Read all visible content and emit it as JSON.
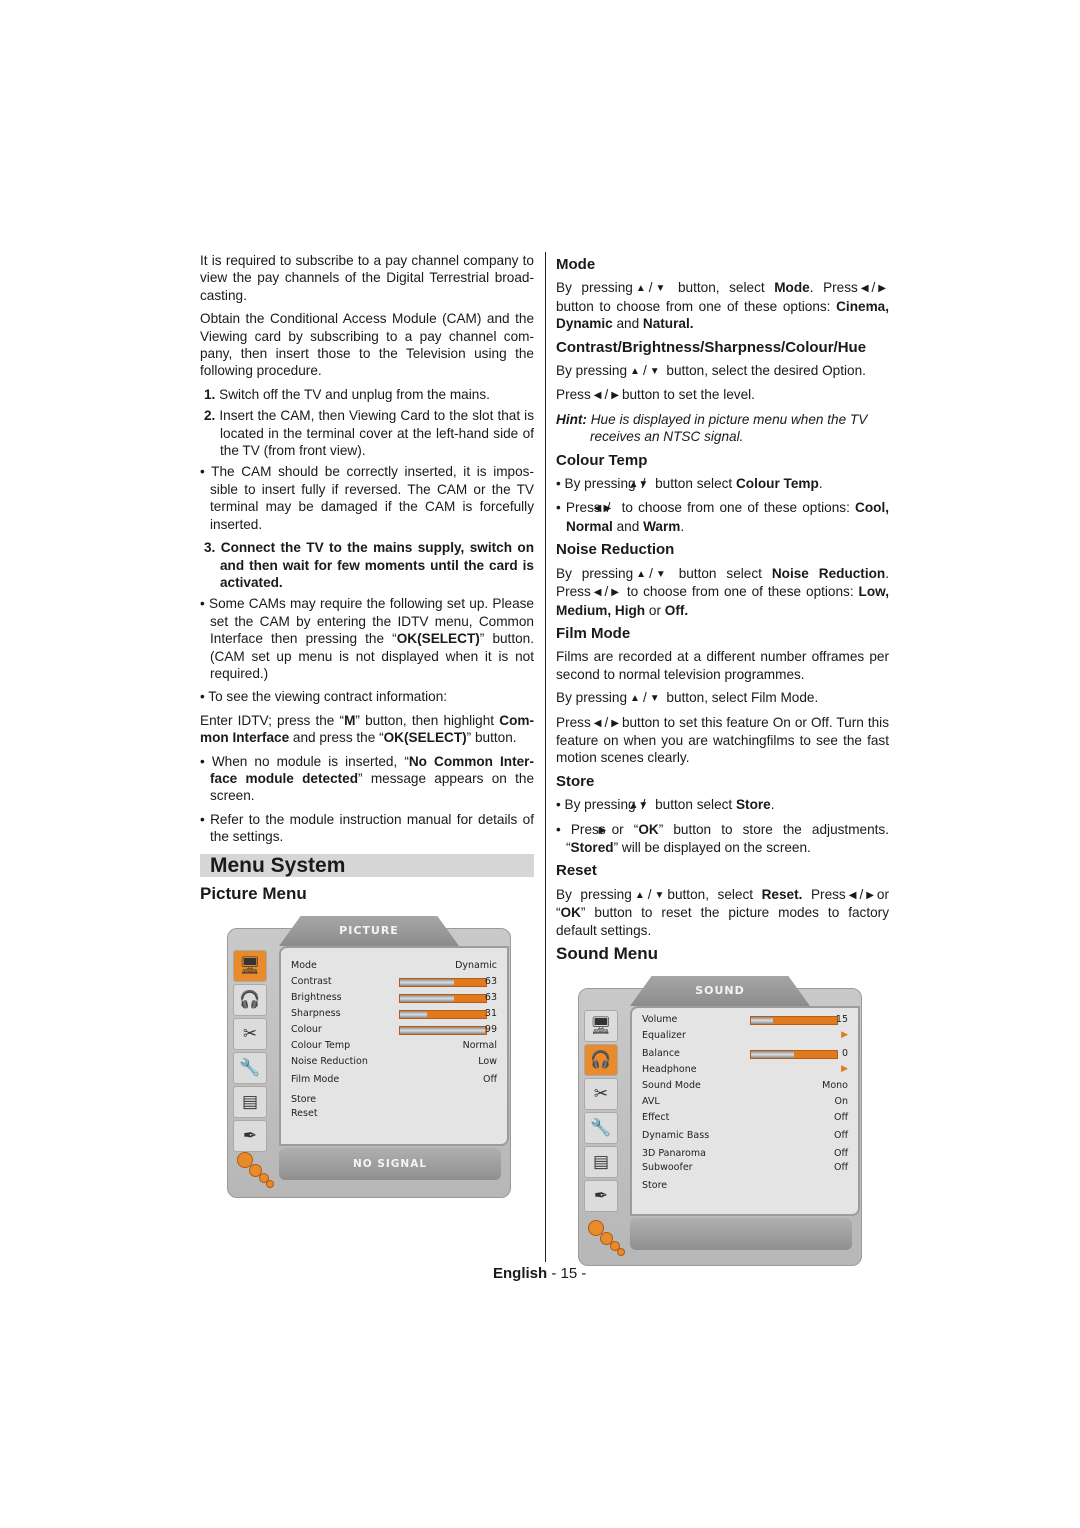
{
  "left": {
    "intro1": "It is required to subscribe to a pay channel company to view the pay channels of the Digital Terrestrial broad-casting.",
    "intro2": "Obtain the Conditional Access Module (CAM) and the Viewing card by subscribing to a pay channel com-pany, then insert those to the Television using the following procedure.",
    "step1_num": "1.",
    "step1": "Switch off the TV and unplug from the mains.",
    "step2_num": "2.",
    "step2": "Insert the CAM, then Viewing Card to the slot that is located in the terminal cover at the left-hand side of the TV (from front view).",
    "bullet1": "• The CAM should be correctly inserted, it is impos-sible to insert fully if reversed. The CAM or the TV terminal may be damaged if the CAM is forcefully inserted.",
    "step3_num": "3.",
    "step3": "Connect the TV to the mains supply, switch on and then wait for few moments until the card is activated.",
    "bullet2_a": "• Some CAMs may require the following set up. Please set the CAM by entering the IDTV menu, Common Interface then pressing the “",
    "bullet2_b": "OK(SELECT)",
    "bullet2_c": "” button. (CAM set up menu is not displayed when it is not required.)",
    "bullet3": "• To see the viewing contract information:",
    "enter_a": "Enter IDTV; press the “",
    "enter_b": "M",
    "enter_c": "” button, then highlight ",
    "enter_d": "Com-mon Interface",
    "enter_e": " and press the “",
    "enter_f": "OK(SELECT)",
    "enter_g": "” button.",
    "bullet4_a": "• When no module is inserted, “",
    "bullet4_b": "No Common Inter-face  module detected",
    "bullet4_c": "” message appears on the screen.",
    "bullet5": "• Refer to the module instruction manual for details of the settings.",
    "menu_system": "Menu System",
    "picture_menu": "Picture Menu"
  },
  "picture_osd": {
    "title": "PICTURE",
    "status": "NO SIGNAL",
    "icons": [
      "picture-icon",
      "headphones-icon",
      "tools-icon",
      "wrench-icon",
      "notepad-icon",
      "feather-icon"
    ],
    "active_icon": 0,
    "rows": [
      {
        "label": "Mode",
        "value": "Dynamic"
      },
      {
        "label": "Contrast",
        "value": "63",
        "level": 0.63
      },
      {
        "label": "Brightness",
        "value": "63",
        "level": 0.63
      },
      {
        "label": "Sharpness",
        "value": "31",
        "level": 0.31
      },
      {
        "label": "Colour",
        "value": "99",
        "level": 0.99
      },
      {
        "label": "Colour Temp",
        "value": "Normal"
      },
      {
        "label": "Noise Reduction",
        "value": "Low"
      },
      {
        "label": "Film Mode",
        "value": "Off"
      },
      {
        "label": "Store",
        "value": ""
      },
      {
        "label": "Reset",
        "value": ""
      }
    ]
  },
  "right": {
    "mode_h": "Mode",
    "mode_a": "By pressing",
    "mode_b": "button, select ",
    "mode_c": "Mode",
    "mode_d": ". Press",
    "mode_e": "button to choose from one of these options: ",
    "mode_f": "Cinema, Dynamic",
    "mode_g": " and ",
    "mode_h2": "Natural.",
    "cb_h": "Contrast/Brightness/Sharpness/Colour/Hue",
    "cb_a": "By pressing",
    "cb_b": "button, select the desired Option.",
    "cb_c": "Press",
    "cb_d": "button to set the level.",
    "hint_a": "Hint:",
    "hint_b": " Hue is displayed in picture menu when the TV receives an NTSC signal.",
    "ct_h": "Colour Temp",
    "ct_a": "• By pressing",
    "ct_b": "button select ",
    "ct_c": "Colour Temp",
    "ct_d": "• Press",
    "ct_e": "to choose from one of these options: ",
    "ct_f": "Cool, Normal",
    "ct_g": " and ",
    "ct_h2": "Warm",
    "nr_h": "Noise Reduction",
    "nr_a": "By pressing",
    "nr_b": "button select ",
    "nr_c": "Noise Reduction",
    "nr_d": "Press",
    "nr_e": "to choose from one of these options: ",
    "nr_f": "Low, Medium, High",
    "nr_g": " or ",
    "nr_h2": "Off.",
    "fm_h": "Film Mode",
    "fm_a": "Films are recorded at a different number offrames per second to normal television programmes.",
    "fm_b": "By pressing",
    "fm_c": "button, select Film Mode.",
    "fm_d": "Press",
    "fm_e": "button to set this feature On or Off. Turn this feature on when you are watchingfilms to see the fast motion scenes clearly.",
    "st_h": "Store",
    "st_a": "• By pressing",
    "st_b": "button  select ",
    "st_c": "Store",
    "st_d": "• Press",
    "st_e": "or “",
    "st_f": "OK",
    "st_g": "” button to store the adjustments. “",
    "st_h2": "Stored",
    "st_i": "” will be displayed on the screen.",
    "rs_h": "Reset",
    "rs_a": "By pressing",
    "rs_b": "button, select ",
    "rs_c": "Reset.",
    "rs_d": " Press",
    "rs_e": "or “",
    "rs_f": "OK",
    "rs_g": "” button to reset the picture modes to factory default settings.",
    "sound_menu": "Sound Menu"
  },
  "sound_osd": {
    "title": "SOUND",
    "status": "",
    "icons": [
      "picture-icon",
      "headphones-icon",
      "tools-icon",
      "wrench-icon",
      "notepad-icon",
      "feather-icon"
    ],
    "active_icon": 1,
    "rows": [
      {
        "label": "Volume",
        "value": "15",
        "level": 0.25
      },
      {
        "label": "Equalizer",
        "value": "▶"
      },
      {
        "label": "Balance",
        "value": "0",
        "level": 0.5
      },
      {
        "label": "Headphone",
        "value": "▶"
      },
      {
        "label": "Sound Mode",
        "value": "Mono"
      },
      {
        "label": "AVL",
        "value": "On"
      },
      {
        "label": "Effect",
        "value": "Off"
      },
      {
        "label": "Dynamic Bass",
        "value": "Off"
      },
      {
        "label": "3D Panaroma",
        "value": "Off"
      },
      {
        "label": "Subwoofer",
        "value": "Off"
      },
      {
        "label": "Store",
        "value": ""
      }
    ]
  },
  "symbols": {
    "up": "▲",
    "down": "▼",
    "left": "◀",
    "right": "▶",
    "slash": "/"
  },
  "footer": {
    "language": "English",
    "page": "- 15 -"
  }
}
